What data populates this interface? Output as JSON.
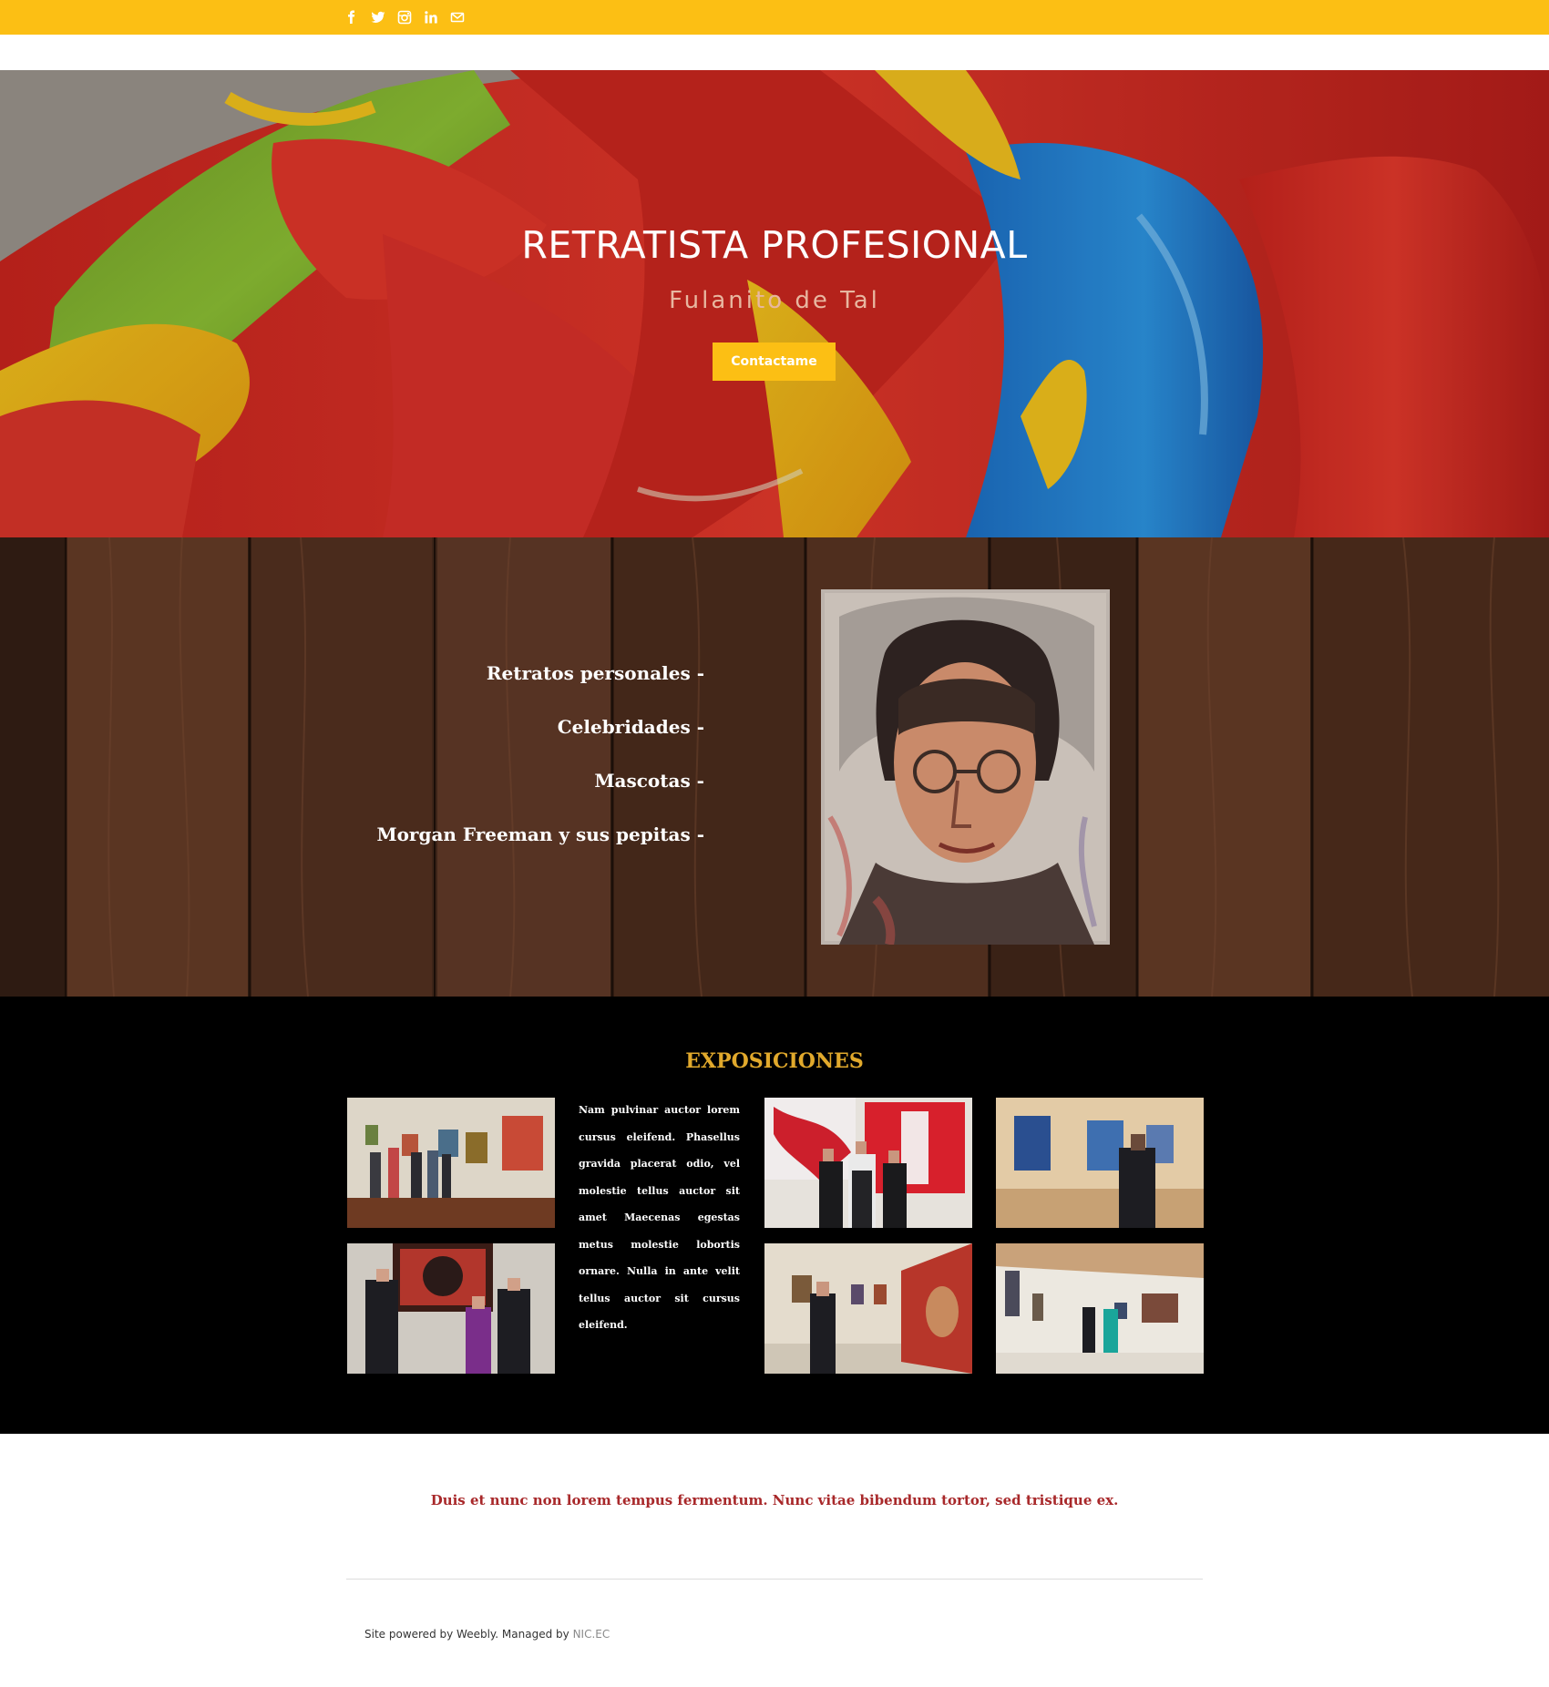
{
  "social": {
    "icons": [
      "facebook-icon",
      "twitter-icon",
      "instagram-icon",
      "linkedin-icon",
      "email-icon"
    ],
    "icon_color": "#ffffff"
  },
  "colors": {
    "accent": "#fcbf14",
    "expo_title": "#e1a92c",
    "quote": "#a8282a",
    "background_dark": "#000000"
  },
  "hero": {
    "title": "RETRATISTA PROFESIONAL",
    "subtitle": "Fulanito de Tal",
    "button_label": "Contactame"
  },
  "services": {
    "items": [
      "Retratos personales -",
      "Celebridades -",
      "Mascotas -",
      "Morgan Freeman y sus pepitas -"
    ]
  },
  "exposiciones": {
    "title": "EXPOSICIONES",
    "text": "Nam pulvinar auctor lorem cursus eleifend. Phasellus gravida placerat odio, vel molestie tellus auctor sit amet Maecenas egestas metus molestie lobortis ornare. Nulla in ante velit tellus auctor sit cursus eleifend."
  },
  "quote": {
    "text": "Duis et nunc non lorem tempus fermentum. Nunc vitae bibendum tortor, sed tristique ex."
  },
  "footer": {
    "powered_text": "Site powered by Weebly. Managed by ",
    "link_text": "NIC.EC"
  }
}
